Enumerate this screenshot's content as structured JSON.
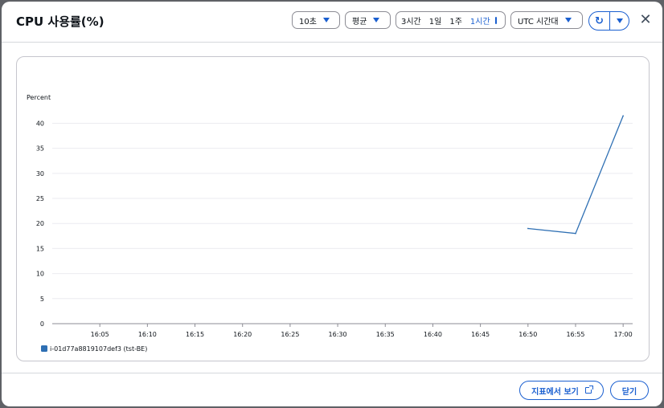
{
  "modal": {
    "title": "CPU 사용률(%)",
    "close_label": "✕"
  },
  "toolbar": {
    "period": "10초",
    "statistic": "평균",
    "ranges": [
      "3시간",
      "1일",
      "1주"
    ],
    "range_active": "1시간",
    "timezone": "UTC 시간대",
    "refresh_icon": "refresh-icon"
  },
  "footer": {
    "view_metrics_label": "지표에서 보기",
    "close_button_label": "닫기"
  },
  "colors": {
    "accent": "#1a5fd0",
    "series": "#2e6fb3"
  },
  "chart_data": {
    "type": "line",
    "ylabel": "Percent",
    "ylim": [
      0,
      42
    ],
    "yticks": [
      0,
      5,
      10,
      15,
      20,
      25,
      30,
      35,
      40
    ],
    "xticks": [
      "16:05",
      "16:10",
      "16:15",
      "16:20",
      "16:25",
      "16:30",
      "16:35",
      "16:40",
      "16:45",
      "16:50",
      "16:55",
      "17:00"
    ],
    "xlim": [
      "16:00",
      "17:01"
    ],
    "grid": true,
    "legend_position": "bottom-left",
    "series": [
      {
        "name": "i-01d77a8819107def3 (tst-BE)",
        "color": "#2e6fb3",
        "points": [
          {
            "x": "16:50",
            "y": 19
          },
          {
            "x": "16:55",
            "y": 18
          },
          {
            "x": "17:00",
            "y": 41.5
          }
        ]
      }
    ]
  }
}
